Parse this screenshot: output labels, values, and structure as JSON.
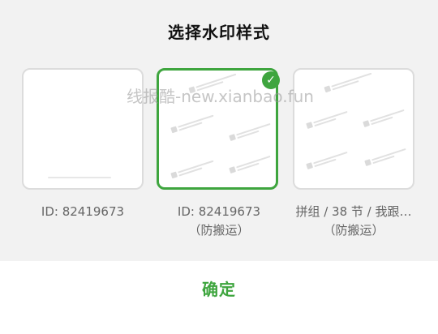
{
  "dialog": {
    "title": "选择水印样式",
    "confirm_label": "确定",
    "accent_color": "#3ea53e"
  },
  "options": [
    {
      "caption": "ID: 82419673",
      "selected": false
    },
    {
      "caption": "ID: 82419673",
      "subcaption": "（防搬运）",
      "selected": true
    },
    {
      "caption": "拼组 / 38 节 / 我跟…",
      "subcaption": "（防搬运）",
      "selected": false
    }
  ],
  "overlay": {
    "text": "线报酷-new.xianbao.fun"
  },
  "icons": {
    "selected_check": "check-circle-icon"
  }
}
